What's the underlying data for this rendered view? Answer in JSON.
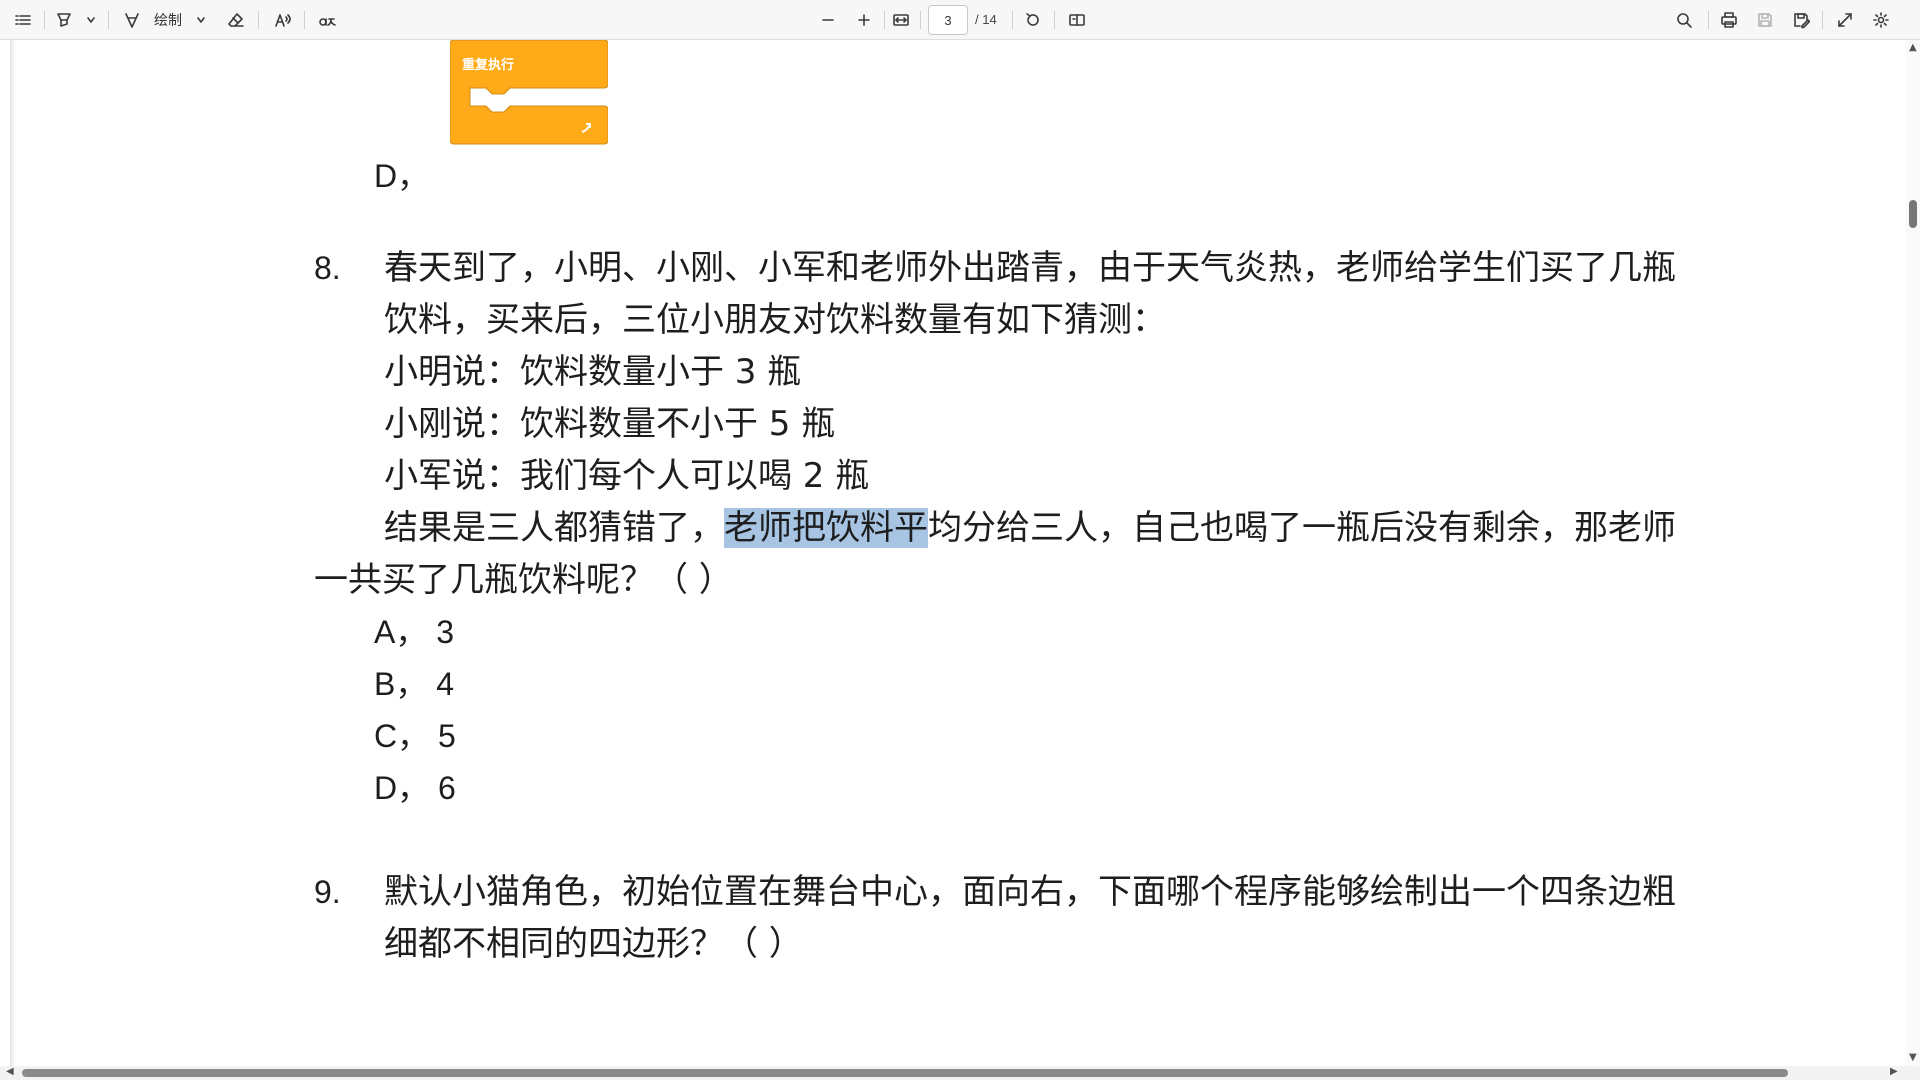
{
  "toolbar": {
    "draw_label": "绘制",
    "current_page": "3",
    "total_pages": "/ 14"
  },
  "block": {
    "label": "重复执行",
    "color": "#ffab19"
  },
  "prev_question": {
    "option_d_label": "D，"
  },
  "q8": {
    "number": "8.",
    "line1": "春天到了，小明、小刚、小军和老师外出踏青，由于天气炎热，老师给学生们买了几瓶",
    "line2": "饮料，买来后，三位小朋友对饮料数量有如下猜测：",
    "line3": "小明说：饮料数量小于 3 瓶",
    "line4": "小刚说：饮料数量不小于 5 瓶",
    "line5": "小军说：我们每个人可以喝 2 瓶",
    "line6_before": "结果是三人都猜错了，",
    "line6_selected": "老师把饮料平",
    "line6_after": "均分给三人，自己也喝了一瓶后没有剩余，那老师",
    "line7": "一共买了几瓶饮料呢？（  ）",
    "options": [
      "A，  3",
      "B，  4",
      "C，  5",
      "D，  6"
    ]
  },
  "q9": {
    "number": "9.",
    "line1": "默认小猫角色，初始位置在舞台中心，面向右，下面哪个程序能够绘制出一个四条边粗",
    "line2": "细都不相同的四边形？（  ）"
  },
  "colors": {
    "selection": "#a7c4e3",
    "toolbar_bg": "#f7f7f7"
  }
}
